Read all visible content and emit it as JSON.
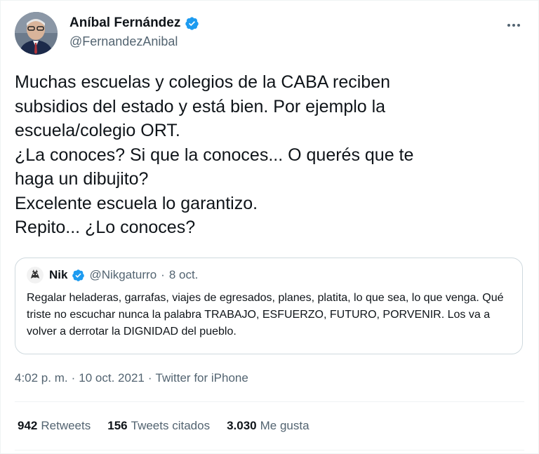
{
  "author": {
    "display_name": "Aníbal Fernández",
    "handle": "@FernandezAnibal",
    "verified": true
  },
  "tweet": {
    "text": "Muchas escuelas y colegios de la CABA reciben\nsubsidios del estado y está bien. Por ejemplo la\nescuela/colegio ORT.\n¿La conoces? Si que la conoces... O querés que te\nhaga un dibujito?\nExcelente escuela lo garantizo.\nRepito... ¿Lo conoces?"
  },
  "quoted": {
    "display_name": "Nik",
    "handle": "@Nikgaturro",
    "separator": "·",
    "date": "8 oct.",
    "text": "Regalar heladeras, garrafas, viajes de egresados, planes, platita, lo que sea, lo que venga. Qué triste no escuchar nunca la palabra TRABAJO, ESFUERZO, FUTURO, PORVENIR. Los va a volver a derrotar la DIGNIDAD del pueblo."
  },
  "meta": {
    "time": "4:02 p. m.",
    "separator1": "·",
    "date": "10 oct. 2021",
    "separator2": "·",
    "source": "Twitter for iPhone"
  },
  "stats": {
    "retweets_count": "942",
    "retweets_label": "Retweets",
    "quotes_count": "156",
    "quotes_label": "Tweets citados",
    "likes_count": "3.030",
    "likes_label": "Me gusta"
  },
  "colors": {
    "verified": "#1d9bf0",
    "secondary_text": "#536471",
    "border": "#cfd9de"
  },
  "icons": {
    "verified": "verified-badge-icon",
    "more": "more-options-icon"
  }
}
